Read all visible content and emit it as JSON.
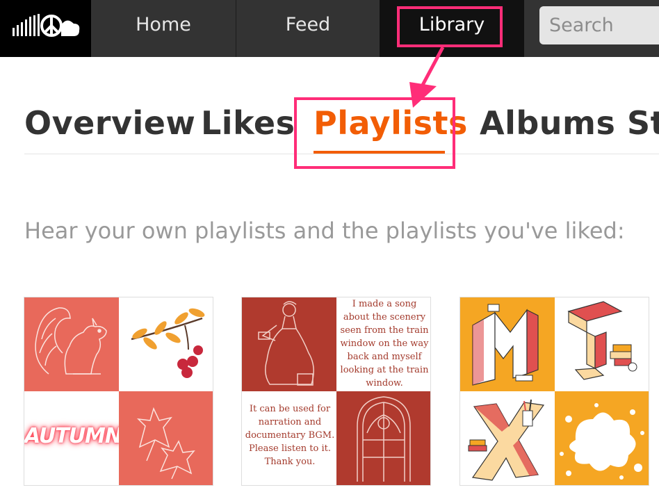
{
  "nav": {
    "logo_icon": "soundcloud-peace-logo",
    "home": "Home",
    "feed": "Feed",
    "library": "Library",
    "search_placeholder": "Search"
  },
  "tabs": {
    "overview": "Overview",
    "likes": "Likes",
    "playlists": "Playlists",
    "albums": "Albums",
    "stations": "St",
    "active": "Playlists",
    "active_color": "#f25d05"
  },
  "subtitle": "Hear your own playlists and the playlists you've liked:",
  "annotation_color": "#ff2d78",
  "playlists": [
    {
      "artwork_text": "AUTUMN",
      "quadrant_icons": [
        "squirrel-icon",
        "branch-berries-icon",
        "autumn-text",
        "maple-leaves-icon"
      ]
    },
    {
      "text_top": "I made a song about the scenery seen from the train window on the way back and myself looking at the train window.",
      "text_bottom": "It can be used for narration and documentary BGM. Please listen to it. Thank you.",
      "quadrant_icons": [
        "victorian-woman-icon",
        "note-text",
        "note-text",
        "gothic-window-icon"
      ]
    },
    {
      "quadrant_icons": [
        "letter-m-icon",
        "letter-i-icon",
        "letter-x-icon",
        "paint-splash-icon"
      ]
    }
  ]
}
